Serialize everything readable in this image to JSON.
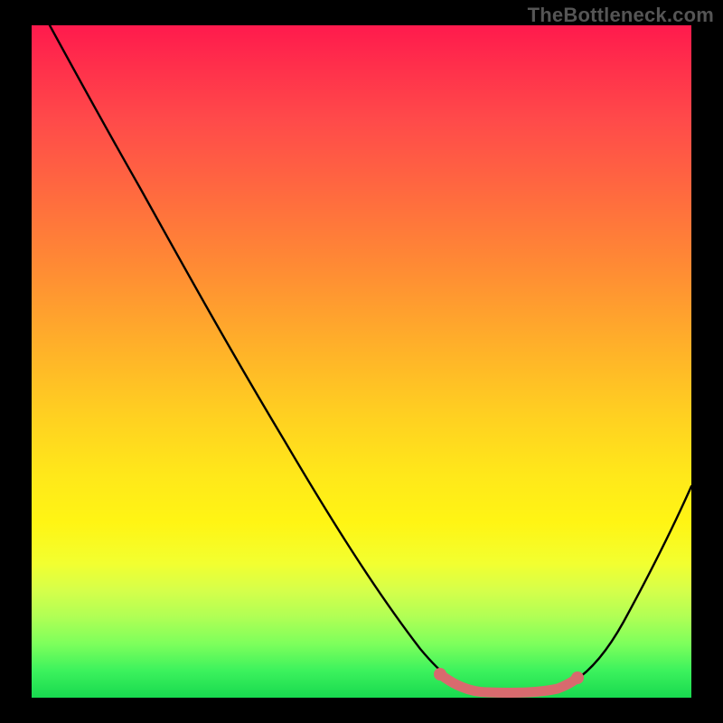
{
  "watermark": "TheBottleneck.com",
  "chart_data": {
    "type": "line",
    "title": "",
    "xlabel": "",
    "ylabel": "",
    "xlim": [
      0,
      100
    ],
    "ylim": [
      0,
      100
    ],
    "grid": false,
    "legend": false,
    "series": [
      {
        "name": "bottleneck-curve",
        "x": [
          3,
          8,
          15,
          22,
          30,
          38,
          46,
          54,
          60,
          66,
          70,
          73,
          76,
          80,
          85,
          90,
          95,
          100
        ],
        "y": [
          100,
          92,
          82,
          72,
          61,
          50,
          39,
          27,
          17,
          8,
          3,
          1,
          1,
          2,
          7,
          15,
          25,
          35
        ],
        "color": "#000000"
      }
    ],
    "highlight": {
      "name": "optimal-range",
      "x_range": [
        63,
        82
      ],
      "y": [
        1,
        1
      ],
      "color": "#d86a6e"
    },
    "background_gradient": {
      "direction": "vertical",
      "stops": [
        {
          "pos": 0,
          "color": "#ff1a4d"
        },
        {
          "pos": 50,
          "color": "#ffc21f"
        },
        {
          "pos": 75,
          "color": "#fff514"
        },
        {
          "pos": 100,
          "color": "#18d94f"
        }
      ]
    }
  }
}
